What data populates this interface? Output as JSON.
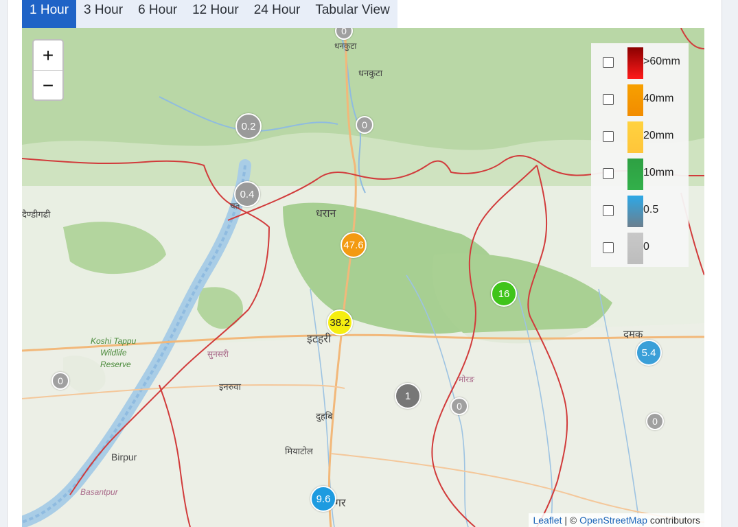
{
  "tabs": [
    {
      "label": "1 Hour",
      "active": true
    },
    {
      "label": "3 Hour",
      "active": false
    },
    {
      "label": "6 Hour",
      "active": false
    },
    {
      "label": "12 Hour",
      "active": false
    },
    {
      "label": "24 Hour",
      "active": false
    },
    {
      "label": "Tabular View",
      "active": false
    }
  ],
  "zoom": {
    "in_label": "+",
    "out_label": "−"
  },
  "legend": {
    "items": [
      {
        "label": ">60mm",
        "color_top": "#8b0000",
        "color_bottom": "#ff1a1a"
      },
      {
        "label": "40mm",
        "color_top": "#f7a000",
        "color_bottom": "#f28c00"
      },
      {
        "label": "20mm",
        "color_top": "#ffd23f",
        "color_bottom": "#ffc53a"
      },
      {
        "label": "10mm",
        "color_top": "#2ea043",
        "color_bottom": "#32b04a"
      },
      {
        "label": "0.5",
        "color_top": "#2da8e6",
        "color_bottom": "#6b7f8e"
      },
      {
        "label": "0",
        "color_top": "#c8c8c8",
        "color_bottom": "#bdbdbd"
      }
    ]
  },
  "stations": [
    {
      "value": "0",
      "color": "#a0a0a0",
      "size": "small"
    },
    {
      "value": "0.2",
      "color": "#9a9a9a",
      "size": "large"
    },
    {
      "value": "0",
      "color": "#a0a0a0",
      "size": "small"
    },
    {
      "value": "0.4",
      "color": "#9a9a9a",
      "size": "large"
    },
    {
      "value": "47.6",
      "color": "#f39a12",
      "size": "large"
    },
    {
      "value": "38.2",
      "color": "#f5ee10",
      "size": "large"
    },
    {
      "value": "16",
      "color": "#3fc41a",
      "size": "large"
    },
    {
      "value": "5.4",
      "color": "#3a9fd8",
      "size": "large"
    },
    {
      "value": "0",
      "color": "#a0a0a0",
      "size": "small"
    },
    {
      "value": "1",
      "color": "#777777",
      "size": "large"
    },
    {
      "value": "0",
      "color": "#a0a0a0",
      "size": "small"
    },
    {
      "value": "0",
      "color": "#a0a0a0",
      "size": "small"
    },
    {
      "value": "9.6",
      "color": "#1e9be0",
      "size": "large"
    }
  ],
  "places": {
    "dhankuta": "धनकुटा",
    "dhankuta_top": "धनकुटा",
    "dharan": "धरान",
    "itahari": "इटहरी",
    "sunsari": "सुनसरी",
    "inaruwa": "इनरुवा",
    "duhabi": "दुहबि",
    "miyatol": "मियाटोल",
    "biratnagar": "बिराटनगर",
    "damak": "दमक",
    "morang": "मोरङ",
    "gaighat": "दैण्डीगढी",
    "chatara": "चत",
    "birpur": "Birpur",
    "basantpur": "Basantpur",
    "koshi_tappu": "Koshi Tappu",
    "wildlife": "Wildlife",
    "reserve": "Reserve",
    "gar": "गर"
  },
  "attribution": {
    "leaflet": "Leaflet",
    "sep": " | © ",
    "osm": "OpenStreetMap",
    "tail": " contributors"
  }
}
